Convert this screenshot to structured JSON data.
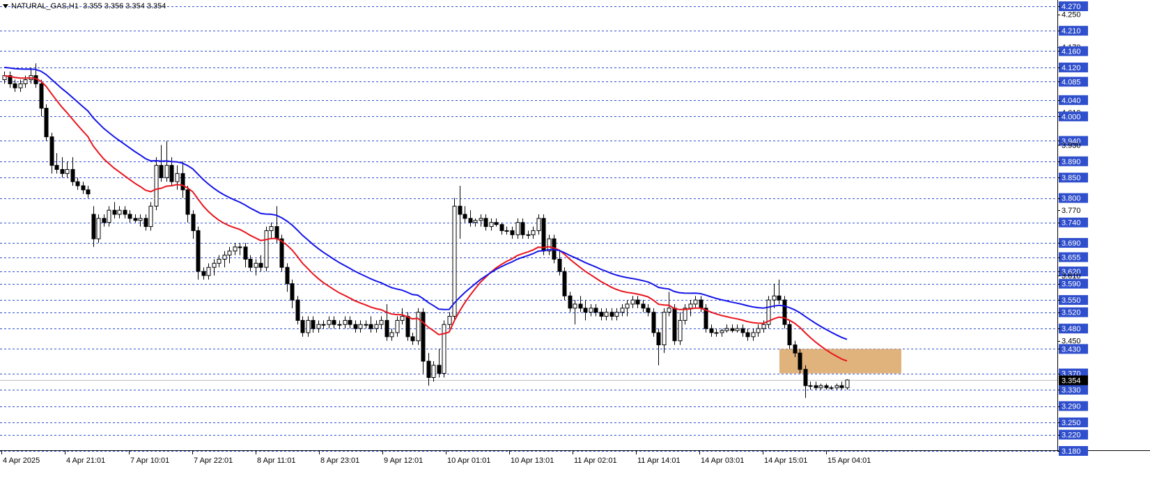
{
  "header": {
    "symbol": "NATURAL_GAS,H1",
    "ohlc": "3.355 3.356 3.354 3.354"
  },
  "colors": {
    "grid": "#2f4fcc",
    "candle_up": "#ffffff",
    "candle_down": "#000000",
    "ma_fast": "#e8141c",
    "ma_slow": "#1414e8",
    "zone": "#e0b27c",
    "price_label_bg": "#000000"
  },
  "chart_data": {
    "type": "candlestick",
    "y_min": 3.18,
    "y_max": 4.27,
    "price_levels": [
      4.27,
      4.21,
      4.16,
      4.12,
      4.085,
      4.04,
      4.0,
      3.94,
      3.89,
      3.85,
      3.8,
      3.74,
      3.69,
      3.655,
      3.62,
      3.59,
      3.55,
      3.52,
      3.48,
      3.43,
      3.37,
      3.33,
      3.29,
      3.25,
      3.22,
      3.18
    ],
    "axis_labels": [
      "4.270",
      "4.250",
      "4.210",
      "4.170",
      "4.160",
      "4.120",
      "4.085",
      "4.040",
      "4.010",
      "4.000",
      "3.940",
      "3.930",
      "3.890",
      "3.850",
      "3.800",
      "3.770",
      "3.740",
      "3.690",
      "3.655",
      "3.620",
      "3.610",
      "3.590",
      "3.550",
      "3.520",
      "3.480",
      "3.450",
      "3.430",
      "3.370",
      "3.330",
      "3.290",
      "3.250",
      "3.220",
      "3.180"
    ],
    "current_price": "3.354",
    "x_labels": [
      "4 Apr 2025",
      "4 Apr 21:01",
      "7 Apr 10:01",
      "7 Apr 22:01",
      "8 Apr 11:01",
      "8 Apr 23:01",
      "9 Apr 12:01",
      "10 Apr 01:01",
      "10 Apr 13:01",
      "11 Apr 02:01",
      "11 Apr 14:01",
      "14 Apr 03:01",
      "14 Apr 15:01",
      "15 Apr 04:01"
    ],
    "zone": {
      "low": 3.37,
      "high": 3.43
    },
    "candles": [
      [
        4.09,
        4.11,
        4.08,
        4.1
      ],
      [
        4.1,
        4.11,
        4.07,
        4.08
      ],
      [
        4.08,
        4.09,
        4.06,
        4.07
      ],
      [
        4.07,
        4.09,
        4.06,
        4.08
      ],
      [
        4.08,
        4.1,
        4.07,
        4.09
      ],
      [
        4.09,
        4.12,
        4.08,
        4.1
      ],
      [
        4.1,
        4.13,
        4.07,
        4.08
      ],
      [
        4.08,
        4.09,
        4.0,
        4.02
      ],
      [
        4.02,
        4.03,
        3.94,
        3.95
      ],
      [
        3.95,
        3.96,
        3.86,
        3.88
      ],
      [
        3.88,
        3.91,
        3.86,
        3.87
      ],
      [
        3.87,
        3.9,
        3.85,
        3.86
      ],
      [
        3.86,
        3.89,
        3.85,
        3.87
      ],
      [
        3.87,
        3.9,
        3.83,
        3.84
      ],
      [
        3.84,
        3.85,
        3.82,
        3.83
      ],
      [
        3.83,
        3.84,
        3.81,
        3.82
      ],
      [
        3.82,
        3.83,
        3.8,
        3.81
      ],
      [
        3.76,
        3.78,
        3.68,
        3.7
      ],
      [
        3.7,
        3.76,
        3.69,
        3.75
      ],
      [
        3.75,
        3.76,
        3.73,
        3.74
      ],
      [
        3.74,
        3.78,
        3.73,
        3.77
      ],
      [
        3.77,
        3.79,
        3.75,
        3.76
      ],
      [
        3.76,
        3.78,
        3.75,
        3.77
      ],
      [
        3.77,
        3.78,
        3.75,
        3.76
      ],
      [
        3.76,
        3.77,
        3.74,
        3.75
      ],
      [
        3.75,
        3.76,
        3.74,
        3.745
      ],
      [
        3.745,
        3.76,
        3.73,
        3.75
      ],
      [
        3.75,
        3.76,
        3.72,
        3.73
      ],
      [
        3.73,
        3.79,
        3.72,
        3.78
      ],
      [
        3.78,
        3.9,
        3.77,
        3.88
      ],
      [
        3.88,
        3.93,
        3.84,
        3.85
      ],
      [
        3.85,
        3.94,
        3.84,
        3.88
      ],
      [
        3.88,
        3.9,
        3.83,
        3.84
      ],
      [
        3.84,
        3.88,
        3.82,
        3.86
      ],
      [
        3.86,
        3.89,
        3.8,
        3.82
      ],
      [
        3.82,
        3.83,
        3.74,
        3.76
      ],
      [
        3.76,
        3.77,
        3.7,
        3.72
      ],
      [
        3.72,
        3.73,
        3.6,
        3.62
      ],
      [
        3.62,
        3.63,
        3.6,
        3.61
      ],
      [
        3.61,
        3.64,
        3.6,
        3.63
      ],
      [
        3.63,
        3.65,
        3.61,
        3.64
      ],
      [
        3.64,
        3.66,
        3.63,
        3.65
      ],
      [
        3.65,
        3.67,
        3.63,
        3.66
      ],
      [
        3.66,
        3.68,
        3.64,
        3.67
      ],
      [
        3.67,
        3.69,
        3.66,
        3.68
      ],
      [
        3.68,
        3.69,
        3.66,
        3.68
      ],
      [
        3.68,
        3.69,
        3.63,
        3.65
      ],
      [
        3.65,
        3.66,
        3.62,
        3.63
      ],
      [
        3.63,
        3.65,
        3.61,
        3.64
      ],
      [
        3.64,
        3.66,
        3.62,
        3.63
      ],
      [
        3.63,
        3.73,
        3.62,
        3.72
      ],
      [
        3.72,
        3.74,
        3.7,
        3.73
      ],
      [
        3.73,
        3.78,
        3.69,
        3.7
      ],
      [
        3.7,
        3.71,
        3.62,
        3.63
      ],
      [
        3.63,
        3.64,
        3.57,
        3.59
      ],
      [
        3.59,
        3.6,
        3.53,
        3.55
      ],
      [
        3.55,
        3.56,
        3.49,
        3.5
      ],
      [
        3.5,
        3.51,
        3.46,
        3.47
      ],
      [
        3.47,
        3.51,
        3.46,
        3.5
      ],
      [
        3.5,
        3.51,
        3.47,
        3.48
      ],
      [
        3.48,
        3.5,
        3.47,
        3.49
      ],
      [
        3.49,
        3.5,
        3.48,
        3.49
      ],
      [
        3.49,
        3.51,
        3.48,
        3.5
      ],
      [
        3.5,
        3.51,
        3.48,
        3.49
      ],
      [
        3.49,
        3.5,
        3.48,
        3.49
      ],
      [
        3.49,
        3.51,
        3.48,
        3.5
      ],
      [
        3.5,
        3.51,
        3.48,
        3.49
      ],
      [
        3.49,
        3.5,
        3.47,
        3.48
      ],
      [
        3.48,
        3.5,
        3.47,
        3.49
      ],
      [
        3.49,
        3.5,
        3.48,
        3.49
      ],
      [
        3.49,
        3.51,
        3.47,
        3.48
      ],
      [
        3.48,
        3.5,
        3.47,
        3.49
      ],
      [
        3.49,
        3.51,
        3.48,
        3.5
      ],
      [
        3.5,
        3.54,
        3.45,
        3.46
      ],
      [
        3.46,
        3.48,
        3.45,
        3.47
      ],
      [
        3.47,
        3.51,
        3.46,
        3.5
      ],
      [
        3.5,
        3.53,
        3.49,
        3.51
      ],
      [
        3.51,
        3.52,
        3.45,
        3.46
      ],
      [
        3.46,
        3.47,
        3.44,
        3.45
      ],
      [
        3.45,
        3.53,
        3.44,
        3.52
      ],
      [
        3.52,
        3.53,
        3.37,
        3.4
      ],
      [
        3.4,
        3.42,
        3.34,
        3.36
      ],
      [
        3.36,
        3.4,
        3.35,
        3.39
      ],
      [
        3.39,
        3.43,
        3.36,
        3.37
      ],
      [
        3.37,
        3.5,
        3.36,
        3.49
      ],
      [
        3.49,
        3.52,
        3.48,
        3.51
      ],
      [
        3.51,
        3.8,
        3.5,
        3.78
      ],
      [
        3.78,
        3.83,
        3.7,
        3.76
      ],
      [
        3.76,
        3.78,
        3.74,
        3.75
      ],
      [
        3.75,
        3.77,
        3.73,
        3.74
      ],
      [
        3.74,
        3.75,
        3.73,
        3.745
      ],
      [
        3.745,
        3.76,
        3.73,
        3.75
      ],
      [
        3.75,
        3.76,
        3.72,
        3.73
      ],
      [
        3.73,
        3.75,
        3.72,
        3.74
      ],
      [
        3.74,
        3.75,
        3.73,
        3.735
      ],
      [
        3.735,
        3.74,
        3.71,
        3.72
      ],
      [
        3.72,
        3.73,
        3.71,
        3.72
      ],
      [
        3.72,
        3.73,
        3.7,
        3.71
      ],
      [
        3.71,
        3.75,
        3.7,
        3.74
      ],
      [
        3.74,
        3.75,
        3.7,
        3.71
      ],
      [
        3.71,
        3.72,
        3.7,
        3.71
      ],
      [
        3.71,
        3.73,
        3.7,
        3.72
      ],
      [
        3.72,
        3.76,
        3.71,
        3.75
      ],
      [
        3.75,
        3.76,
        3.66,
        3.67
      ],
      [
        3.67,
        3.71,
        3.66,
        3.7
      ],
      [
        3.7,
        3.71,
        3.64,
        3.65
      ],
      [
        3.65,
        3.67,
        3.61,
        3.62
      ],
      [
        3.62,
        3.63,
        3.55,
        3.56
      ],
      [
        3.56,
        3.57,
        3.52,
        3.53
      ],
      [
        3.53,
        3.55,
        3.49,
        3.54
      ],
      [
        3.54,
        3.56,
        3.52,
        3.53
      ],
      [
        3.53,
        3.55,
        3.5,
        3.52
      ],
      [
        3.52,
        3.54,
        3.51,
        3.53
      ],
      [
        3.53,
        3.54,
        3.51,
        3.52
      ],
      [
        3.52,
        3.53,
        3.5,
        3.51
      ],
      [
        3.51,
        3.53,
        3.5,
        3.52
      ],
      [
        3.52,
        3.53,
        3.5,
        3.51
      ],
      [
        3.51,
        3.53,
        3.5,
        3.52
      ],
      [
        3.52,
        3.54,
        3.51,
        3.53
      ],
      [
        3.53,
        3.55,
        3.51,
        3.54
      ],
      [
        3.54,
        3.56,
        3.53,
        3.55
      ],
      [
        3.55,
        3.56,
        3.53,
        3.54
      ],
      [
        3.54,
        3.55,
        3.52,
        3.53
      ],
      [
        3.53,
        3.54,
        3.51,
        3.52
      ],
      [
        3.52,
        3.53,
        3.46,
        3.47
      ],
      [
        3.47,
        3.48,
        3.39,
        3.44
      ],
      [
        3.44,
        3.53,
        3.42,
        3.52
      ],
      [
        3.52,
        3.57,
        3.51,
        3.53
      ],
      [
        3.53,
        3.54,
        3.44,
        3.45
      ],
      [
        3.45,
        3.52,
        3.44,
        3.5
      ],
      [
        3.5,
        3.54,
        3.49,
        3.53
      ],
      [
        3.53,
        3.55,
        3.51,
        3.54
      ],
      [
        3.54,
        3.56,
        3.53,
        3.55
      ],
      [
        3.55,
        3.56,
        3.52,
        3.53
      ],
      [
        3.53,
        3.54,
        3.47,
        3.48
      ],
      [
        3.48,
        3.49,
        3.46,
        3.47
      ],
      [
        3.47,
        3.48,
        3.46,
        3.47
      ],
      [
        3.47,
        3.48,
        3.46,
        3.475
      ],
      [
        3.475,
        3.49,
        3.47,
        3.48
      ],
      [
        3.48,
        3.49,
        3.47,
        3.475
      ],
      [
        3.475,
        3.49,
        3.47,
        3.48
      ],
      [
        3.48,
        3.49,
        3.46,
        3.47
      ],
      [
        3.47,
        3.48,
        3.45,
        3.46
      ],
      [
        3.46,
        3.48,
        3.45,
        3.47
      ],
      [
        3.47,
        3.49,
        3.46,
        3.48
      ],
      [
        3.48,
        3.5,
        3.47,
        3.49
      ],
      [
        3.49,
        3.56,
        3.48,
        3.55
      ],
      [
        3.55,
        3.59,
        3.53,
        3.56
      ],
      [
        3.56,
        3.6,
        3.54,
        3.55
      ],
      [
        3.55,
        3.56,
        3.48,
        3.49
      ],
      [
        3.49,
        3.5,
        3.43,
        3.44
      ],
      [
        3.44,
        3.45,
        3.41,
        3.42
      ],
      [
        3.42,
        3.43,
        3.37,
        3.38
      ],
      [
        3.38,
        3.39,
        3.31,
        3.34
      ],
      [
        3.34,
        3.35,
        3.33,
        3.34
      ],
      [
        3.34,
        3.35,
        3.33,
        3.335
      ],
      [
        3.335,
        3.345,
        3.33,
        3.34
      ],
      [
        3.34,
        3.345,
        3.33,
        3.335
      ],
      [
        3.335,
        3.34,
        3.33,
        3.335
      ],
      [
        3.335,
        3.345,
        3.33,
        3.34
      ],
      [
        3.34,
        3.35,
        3.33,
        3.335
      ],
      [
        3.335,
        3.356,
        3.33,
        3.354
      ]
    ]
  }
}
